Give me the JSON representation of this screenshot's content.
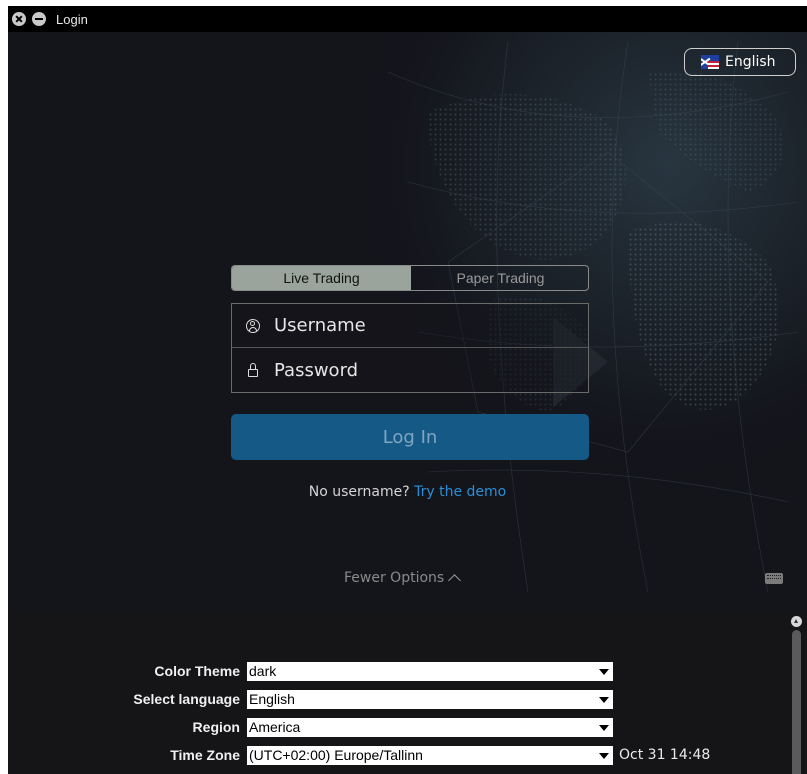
{
  "window": {
    "title": "Login"
  },
  "language_button": {
    "label": "English",
    "flag": "uk-flag-icon"
  },
  "mode_tabs": [
    {
      "label": "Live Trading",
      "active": true
    },
    {
      "label": "Paper Trading",
      "active": false
    }
  ],
  "username": {
    "placeholder": "Username",
    "value": ""
  },
  "password": {
    "placeholder": "Password",
    "value": ""
  },
  "login_button": {
    "label": "Log In"
  },
  "demo": {
    "prefix": "No username?",
    "link": "Try the demo"
  },
  "fewer_options": {
    "label": "Fewer Options"
  },
  "options": [
    {
      "label": "Color Theme",
      "value": "dark"
    },
    {
      "label": "Select language",
      "value": "English"
    },
    {
      "label": "Region",
      "value": "America"
    },
    {
      "label": "Time Zone",
      "value": "(UTC+02:00) Europe/Tallinn",
      "extra": "Oct 31 14:48"
    }
  ],
  "colors": {
    "background": "#13131a",
    "login_button": "#155a86",
    "link": "#2a8fd8",
    "active_tab": "#9aa39c"
  }
}
